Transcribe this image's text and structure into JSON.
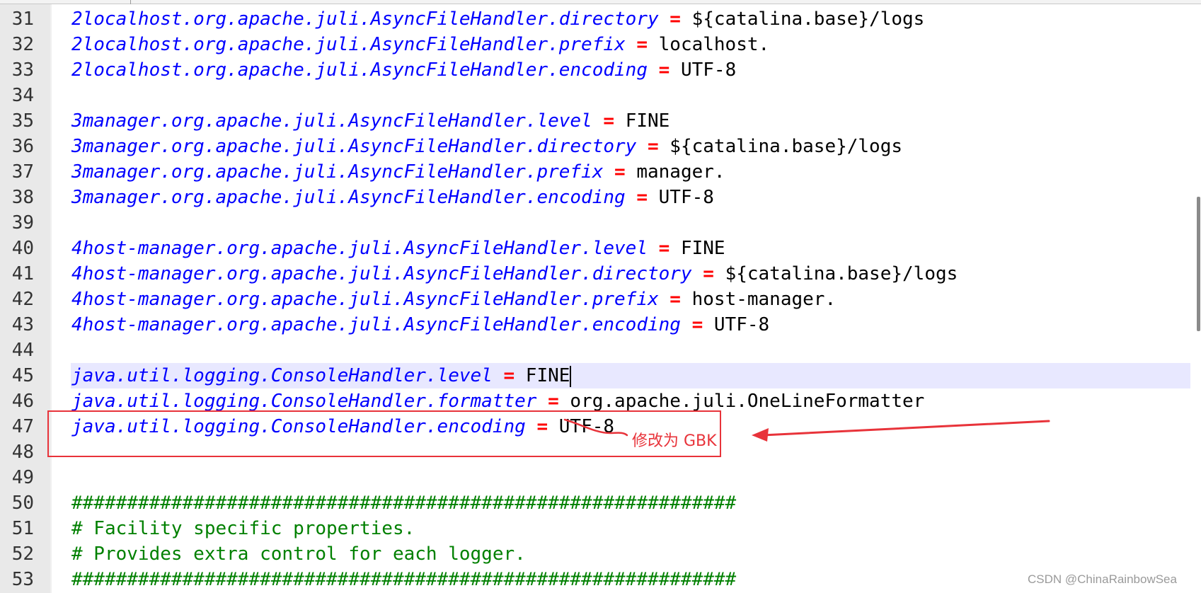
{
  "editor": {
    "lines": [
      {
        "num": "31",
        "key": "2localhost.org.apache.juli.AsyncFileHandler.directory",
        "eq": " = ",
        "value": "${catalina.base}/logs",
        "comment": ""
      },
      {
        "num": "32",
        "key": "2localhost.org.apache.juli.AsyncFileHandler.prefix",
        "eq": " = ",
        "value": "localhost.",
        "comment": ""
      },
      {
        "num": "33",
        "key": "2localhost.org.apache.juli.AsyncFileHandler.encoding",
        "eq": " = ",
        "value": "UTF-8",
        "comment": ""
      },
      {
        "num": "34",
        "key": "",
        "eq": "",
        "value": "",
        "comment": ""
      },
      {
        "num": "35",
        "key": "3manager.org.apache.juli.AsyncFileHandler.level",
        "eq": " = ",
        "value": "FINE",
        "comment": ""
      },
      {
        "num": "36",
        "key": "3manager.org.apache.juli.AsyncFileHandler.directory",
        "eq": " = ",
        "value": "${catalina.base}/logs",
        "comment": ""
      },
      {
        "num": "37",
        "key": "3manager.org.apache.juli.AsyncFileHandler.prefix",
        "eq": " = ",
        "value": "manager.",
        "comment": ""
      },
      {
        "num": "38",
        "key": "3manager.org.apache.juli.AsyncFileHandler.encoding",
        "eq": " = ",
        "value": "UTF-8",
        "comment": ""
      },
      {
        "num": "39",
        "key": "",
        "eq": "",
        "value": "",
        "comment": ""
      },
      {
        "num": "40",
        "key": "4host-manager.org.apache.juli.AsyncFileHandler.level",
        "eq": " = ",
        "value": "FINE",
        "comment": ""
      },
      {
        "num": "41",
        "key": "4host-manager.org.apache.juli.AsyncFileHandler.directory",
        "eq": " = ",
        "value": "${catalina.base}/logs",
        "comment": ""
      },
      {
        "num": "42",
        "key": "4host-manager.org.apache.juli.AsyncFileHandler.prefix",
        "eq": " = ",
        "value": "host-manager.",
        "comment": ""
      },
      {
        "num": "43",
        "key": "4host-manager.org.apache.juli.AsyncFileHandler.encoding",
        "eq": " = ",
        "value": "UTF-8",
        "comment": ""
      },
      {
        "num": "44",
        "key": "",
        "eq": "",
        "value": "",
        "comment": ""
      },
      {
        "num": "45",
        "key": "java.util.logging.ConsoleHandler.level",
        "eq": " = ",
        "value": "FINE",
        "comment": ""
      },
      {
        "num": "46",
        "key": "java.util.logging.ConsoleHandler.formatter",
        "eq": " = ",
        "value": "org.apache.juli.OneLineFormatter",
        "comment": ""
      },
      {
        "num": "47",
        "key": "java.util.logging.ConsoleHandler.encoding",
        "eq": " = ",
        "value": "UTF-8",
        "comment": ""
      },
      {
        "num": "48",
        "key": "",
        "eq": "",
        "value": "",
        "comment": ""
      },
      {
        "num": "49",
        "key": "",
        "eq": "",
        "value": "",
        "comment": ""
      },
      {
        "num": "50",
        "key": "",
        "eq": "",
        "value": "",
        "comment": "############################################################"
      },
      {
        "num": "51",
        "key": "",
        "eq": "",
        "value": "",
        "comment": "# Facility specific properties."
      },
      {
        "num": "52",
        "key": "",
        "eq": "",
        "value": "",
        "comment": "# Provides extra control for each logger."
      },
      {
        "num": "53",
        "key": "",
        "eq": "",
        "value": "",
        "comment": "############################################################"
      }
    ],
    "current_line": "45"
  },
  "annotation": {
    "text": "修改为 GBK",
    "color": "#e8333a"
  },
  "colors": {
    "key": "#0000ff",
    "operator": "#ff0000",
    "value": "#000000",
    "comment": "#008000",
    "gutter": "#e9e9e9",
    "current_line_bg": "#e8e8ff"
  },
  "watermark": "CSDN @ChinaRainbowSea"
}
